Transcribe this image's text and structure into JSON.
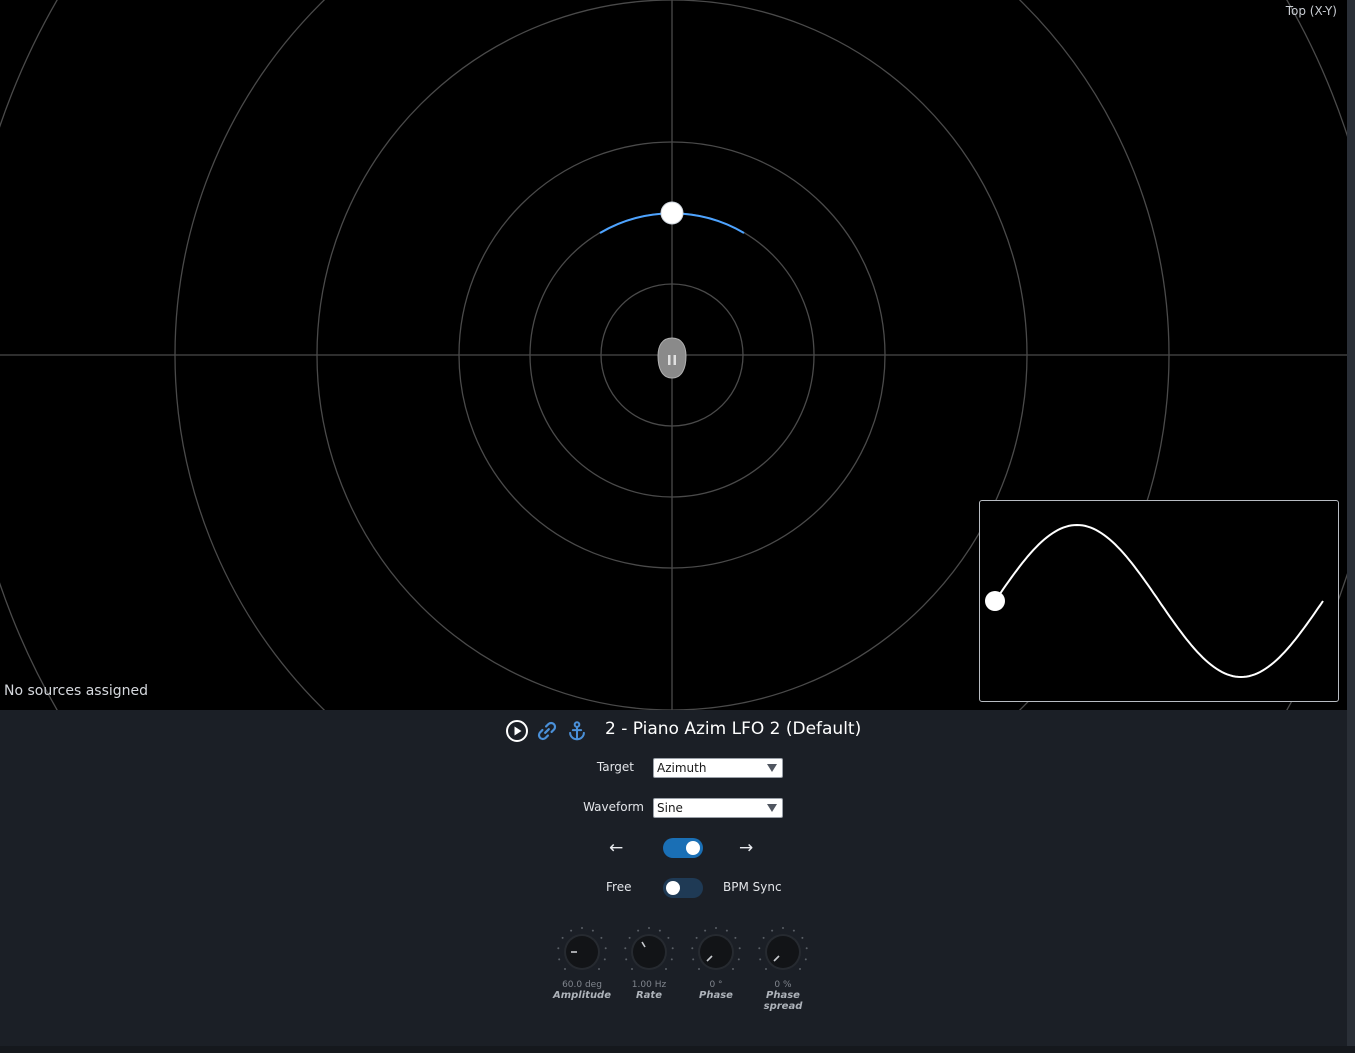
{
  "view": {
    "mode_label": "Top (X-Y)",
    "status_text": "No sources assigned",
    "lfo_arc_color": "#4da3ff",
    "waveform_preview": {
      "shape": "sine",
      "cycles": 1
    }
  },
  "toolbar": {
    "play_icon": "play-circle-icon",
    "link_icon": "link-icon",
    "anchor_icon": "anchor-icon",
    "accent_color": "#4a90d9"
  },
  "lfo": {
    "title": "2 - Piano Azim LFO 2 (Default)",
    "target_label": "Target",
    "target_value": "Azimuth",
    "waveform_label": "Waveform",
    "waveform_value": "Sine",
    "direction_left": "←",
    "direction_right": "→",
    "direction_toggle_on": true,
    "sync_free_label": "Free",
    "sync_bpm_label": "BPM Sync",
    "bpm_sync_on": false
  },
  "knobs": [
    {
      "label": "Amplitude",
      "value": "60.0 deg"
    },
    {
      "label": "Rate",
      "value": "1.00 Hz"
    },
    {
      "label": "Phase",
      "value": "0 °"
    },
    {
      "label": "Phase spread",
      "value": "0 %"
    }
  ],
  "colors": {
    "toggle_on": "#1a6fb5",
    "toggle_off": "#1f3a55",
    "panel_bg": "#1b1f26"
  }
}
